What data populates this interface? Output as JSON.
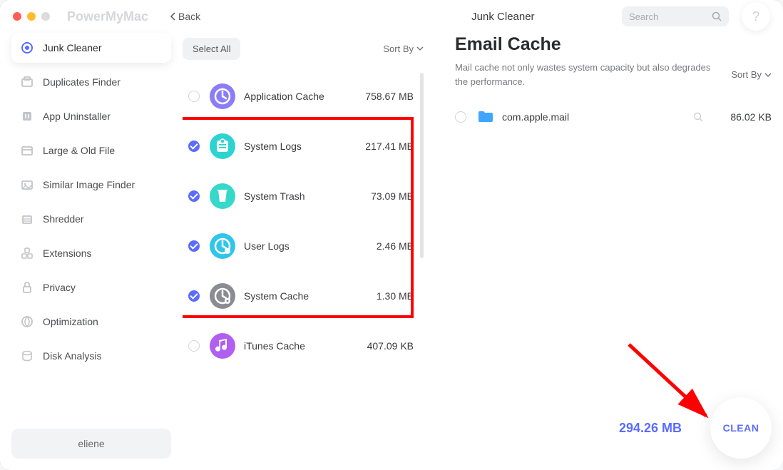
{
  "app": {
    "name": "PowerMyMac",
    "back": "Back",
    "module": "Junk Cleaner",
    "search_placeholder": "Search",
    "help": "?"
  },
  "sidebar": {
    "items": [
      {
        "label": "Junk Cleaner"
      },
      {
        "label": "Duplicates Finder"
      },
      {
        "label": "App Uninstaller"
      },
      {
        "label": "Large & Old File"
      },
      {
        "label": "Similar Image Finder"
      },
      {
        "label": "Shredder"
      },
      {
        "label": "Extensions"
      },
      {
        "label": "Privacy"
      },
      {
        "label": "Optimization"
      },
      {
        "label": "Disk Analysis"
      }
    ],
    "user": "eliene"
  },
  "middle": {
    "select_all": "Select All",
    "sort_by": "Sort By",
    "categories": [
      {
        "name": "Application Cache",
        "size": "758.67 MB",
        "checked": false,
        "icon_bg": "#8b7cf8"
      },
      {
        "name": "System Logs",
        "size": "217.41 MB",
        "checked": true,
        "icon_bg": "#2bd4d0"
      },
      {
        "name": "System Trash",
        "size": "73.09 MB",
        "checked": true,
        "icon_bg": "#35d8c9"
      },
      {
        "name": "User Logs",
        "size": "2.46 MB",
        "checked": true,
        "icon_bg": "#2fc6ea"
      },
      {
        "name": "System Cache",
        "size": "1.30 MB",
        "checked": true,
        "icon_bg": "#8a8c91"
      },
      {
        "name": "iTunes Cache",
        "size": "407.09 KB",
        "checked": false,
        "icon_bg": "#b15ff0"
      }
    ]
  },
  "right": {
    "title": "Email Cache",
    "desc": "Mail cache not only wastes system capacity but also degrades the performance.",
    "sort_by": "Sort By",
    "items": [
      {
        "name": "com.apple.mail",
        "size": "86.02 KB",
        "checked": false
      }
    ]
  },
  "footer": {
    "total": "294.26 MB",
    "clean": "CLEAN"
  },
  "annotations": {
    "highlight": {
      "top_row": 1,
      "bottom_row": 4
    },
    "arrow": true
  }
}
